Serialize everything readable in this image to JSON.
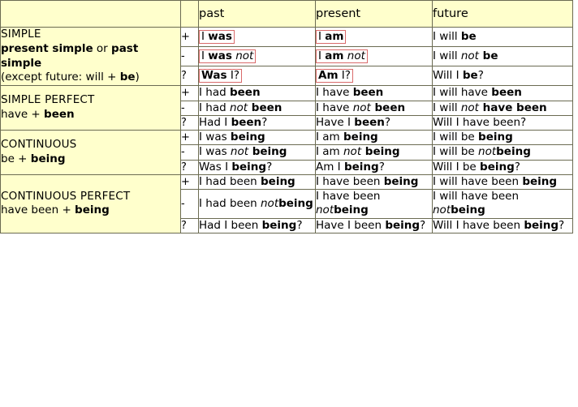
{
  "table": {
    "headers": {
      "blank": "",
      "sign": "",
      "past": "past",
      "present": "present",
      "future": "future"
    },
    "signs": {
      "positive": "+",
      "negative": "-",
      "question": "?"
    },
    "colors": {
      "header_background": "#ffffcc",
      "form_background": "#ffffcc",
      "cell_background": "#ffffff",
      "highlight_border": "#d96a6a",
      "grid_border": "#555555",
      "outer_border": "#6b6b52"
    },
    "blocks": [
      {
        "id": "simple",
        "title": "SIMPLE",
        "formula_line1_a": "present simple",
        "formula_line1_b": " or ",
        "formula_line1_c": "past simple",
        "note_a": "(except future: will + ",
        "note_b": "be",
        "note_c": ")",
        "rows": [
          {
            "sign": "+",
            "past": {
              "plain1": "I ",
              "bold1": "was",
              "plain2": "",
              "italic": "",
              "bold2": "",
              "plain3": "",
              "highlight": true
            },
            "present": {
              "plain1": "I ",
              "bold1": "am",
              "plain2": "",
              "italic": "",
              "bold2": "",
              "plain3": "",
              "highlight": true
            },
            "future": {
              "plain1": "I will ",
              "bold1": "be",
              "plain2": "",
              "italic": "",
              "bold2": "",
              "plain3": "",
              "highlight": false
            }
          },
          {
            "sign": "-",
            "past": {
              "plain1": "I ",
              "bold1": "was",
              "plain2": " ",
              "italic": "not",
              "bold2": "",
              "plain3": "",
              "highlight": true
            },
            "present": {
              "plain1": "I ",
              "bold1": "am",
              "plain2": " ",
              "italic": "not",
              "bold2": "",
              "plain3": "",
              "highlight": true
            },
            "future": {
              "plain1": "I will ",
              "bold1": "",
              "plain2": "",
              "italic": "not",
              "bold2": " be",
              "plain3": "",
              "highlight": false
            }
          },
          {
            "sign": "?",
            "past": {
              "plain1": "",
              "bold1": "Was",
              "plain2": " I?",
              "italic": "",
              "bold2": "",
              "plain3": "",
              "highlight": true
            },
            "present": {
              "plain1": "",
              "bold1": "Am",
              "plain2": " I?",
              "italic": "",
              "bold2": "",
              "plain3": "",
              "highlight": true
            },
            "future": {
              "plain1": "Will I ",
              "bold1": "be",
              "plain2": "?",
              "italic": "",
              "bold2": "",
              "plain3": "",
              "highlight": false
            }
          }
        ]
      },
      {
        "id": "simple-perfect",
        "title": "SIMPLE PERFECT",
        "formula_a": "have + ",
        "formula_b": "been",
        "rows": [
          {
            "sign": "+",
            "past": {
              "plain1": "I had ",
              "bold1": "been",
              "plain2": "",
              "italic": "",
              "bold2": "",
              "plain3": "",
              "highlight": false
            },
            "present": {
              "plain1": "I have ",
              "bold1": "been",
              "plain2": "",
              "italic": "",
              "bold2": "",
              "plain3": "",
              "highlight": false
            },
            "future": {
              "plain1": "I will have ",
              "bold1": "been",
              "plain2": "",
              "italic": "",
              "bold2": "",
              "plain3": "",
              "highlight": false
            }
          },
          {
            "sign": "-",
            "past": {
              "plain1": "I had ",
              "bold1": "",
              "plain2": "",
              "italic": "not",
              "bold2": " been",
              "plain3": "",
              "highlight": false
            },
            "present": {
              "plain1": "I have ",
              "bold1": "",
              "plain2": "",
              "italic": "not",
              "bold2": " been",
              "plain3": "",
              "highlight": false
            },
            "future": {
              "plain1": "I will ",
              "bold1": "",
              "plain2": "",
              "italic": "not",
              "bold2": " have been",
              "plain3": "",
              "highlight": false
            }
          },
          {
            "sign": "?",
            "past": {
              "plain1": "Had I ",
              "bold1": "been",
              "plain2": "?",
              "italic": "",
              "bold2": "",
              "plain3": "",
              "highlight": false
            },
            "present": {
              "plain1": "Have I ",
              "bold1": "been",
              "plain2": "?",
              "italic": "",
              "bold2": "",
              "plain3": "",
              "highlight": false
            },
            "future": {
              "plain1": "Will I have been?",
              "bold1": "",
              "plain2": "",
              "italic": "",
              "bold2": "",
              "plain3": "",
              "highlight": false
            }
          }
        ]
      },
      {
        "id": "continuous",
        "title": "CONTINUOUS",
        "formula_a": "be + ",
        "formula_b": "being",
        "rows": [
          {
            "sign": "+",
            "past": {
              "plain1": "I was ",
              "bold1": "being",
              "plain2": "",
              "italic": "",
              "bold2": "",
              "plain3": "",
              "highlight": false
            },
            "present": {
              "plain1": "I am ",
              "bold1": "being",
              "plain2": "",
              "italic": "",
              "bold2": "",
              "plain3": "",
              "highlight": false
            },
            "future": {
              "plain1": "I will be ",
              "bold1": "being",
              "plain2": "",
              "italic": "",
              "bold2": "",
              "plain3": "",
              "highlight": false
            }
          },
          {
            "sign": "-",
            "past": {
              "plain1": "I was ",
              "bold1": "",
              "plain2": "",
              "italic": "not",
              "bold2": " being",
              "plain3": "",
              "highlight": false
            },
            "present": {
              "plain1": "I am ",
              "bold1": "",
              "plain2": "",
              "italic": "not",
              "bold2": " being",
              "plain3": "",
              "highlight": false
            },
            "future": {
              "plain1": "I will ",
              "bold1": "",
              "plain2": " be ",
              "italic": "not",
              "bold2": "being",
              "plain3": "",
              "highlight": false
            }
          },
          {
            "sign": "?",
            "past": {
              "plain1": "Was I ",
              "bold1": "being",
              "plain2": "?",
              "italic": "",
              "bold2": "",
              "plain3": "",
              "highlight": false
            },
            "present": {
              "plain1": "Am I ",
              "bold1": "being",
              "plain2": "?",
              "italic": "",
              "bold2": "",
              "plain3": "",
              "highlight": false
            },
            "future": {
              "plain1": "Will I be ",
              "bold1": "being",
              "plain2": "?",
              "italic": "",
              "bold2": "",
              "plain3": "",
              "highlight": false
            }
          }
        ]
      },
      {
        "id": "continuous-perfect",
        "title": "CONTINUOUS PERFECT",
        "formula_a": "have been + ",
        "formula_b": "being",
        "rows": [
          {
            "sign": "+",
            "past": {
              "plain1": "I had been ",
              "bold1": "being",
              "plain2": "",
              "italic": "",
              "bold2": "",
              "plain3": "",
              "highlight": false
            },
            "present": {
              "plain1": "I have been ",
              "bold1": "being",
              "plain2": "",
              "italic": "",
              "bold2": "",
              "plain3": "",
              "highlight": false
            },
            "future": {
              "plain1": "I will have been ",
              "bold1": "being",
              "plain2": "",
              "italic": "",
              "bold2": "",
              "plain3": "",
              "highlight": false
            }
          },
          {
            "sign": "-",
            "past": {
              "plain1": "I had ",
              "bold1": "",
              "plain2": " been ",
              "italic": "not",
              "bold2": "being",
              "plain3": "",
              "highlight": false
            },
            "present": {
              "plain1": "I have ",
              "bold1": "",
              "plain2": " been ",
              "italic": "not",
              "bold2": "being",
              "plain3": "",
              "highlight": false
            },
            "future": {
              "plain1": "I will ",
              "bold1": "",
              "plain2": " have been ",
              "italic": "not",
              "bold2": "being",
              "plain3": "",
              "highlight": false
            }
          },
          {
            "sign": "?",
            "past": {
              "plain1": "Had I been ",
              "bold1": "being",
              "plain2": "?",
              "italic": "",
              "bold2": "",
              "plain3": "",
              "highlight": false
            },
            "present": {
              "plain1": "Have I been ",
              "bold1": "being",
              "plain2": "?",
              "italic": "",
              "bold2": "",
              "plain3": "",
              "highlight": false
            },
            "future": {
              "plain1": "Will I have been ",
              "bold1": "being",
              "plain2": "?",
              "italic": "",
              "bold2": "",
              "plain3": "",
              "highlight": false
            }
          }
        ]
      }
    ]
  }
}
